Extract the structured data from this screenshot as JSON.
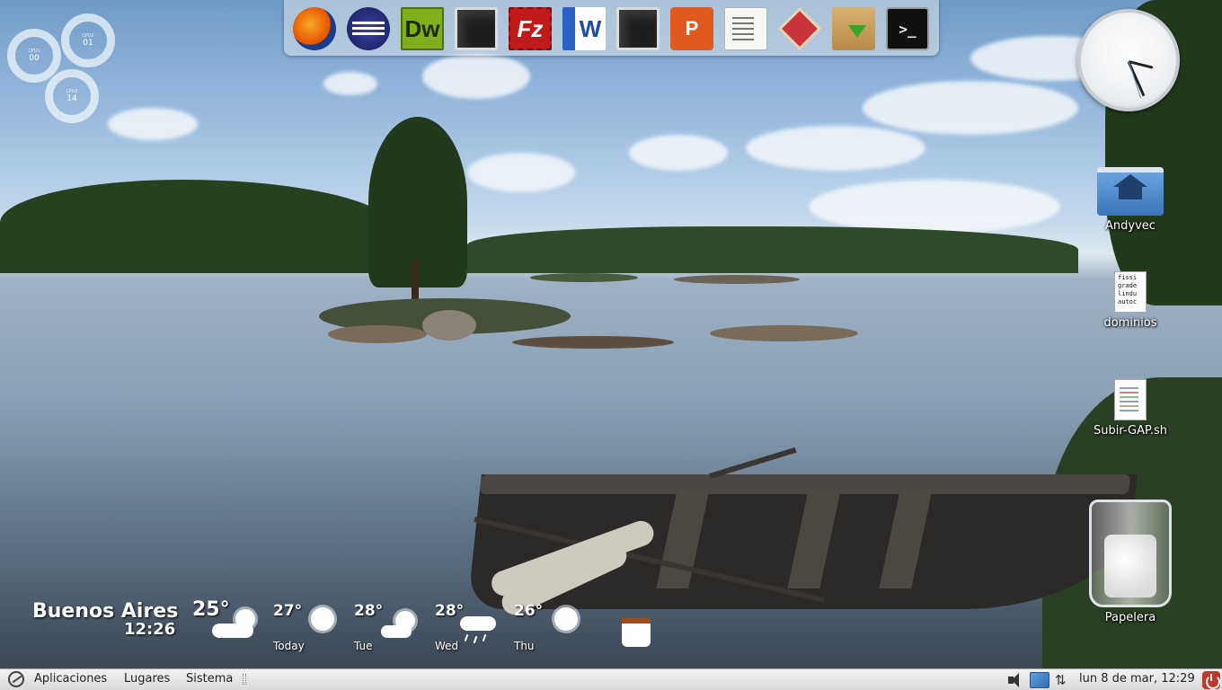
{
  "dock": {
    "items": [
      {
        "name": "firefox",
        "label": ""
      },
      {
        "name": "eclipse",
        "label": ""
      },
      {
        "name": "dreamweaver",
        "label": "Dw"
      },
      {
        "name": "screen-1",
        "label": ""
      },
      {
        "name": "filezilla",
        "label": "Fz"
      },
      {
        "name": "word",
        "label": "W"
      },
      {
        "name": "screen-2",
        "label": ""
      },
      {
        "name": "powerpoint",
        "label": "P"
      },
      {
        "name": "text-editor",
        "label": ""
      },
      {
        "name": "diamond-app",
        "label": ""
      },
      {
        "name": "package-installer",
        "label": ""
      },
      {
        "name": "terminal",
        "label": ">_"
      }
    ]
  },
  "cpu_gauges": [
    {
      "label": "CPU1",
      "value": "00"
    },
    {
      "label": "CPU2",
      "value": "01"
    },
    {
      "label": "CPU3",
      "value": "14"
    }
  ],
  "desktop": {
    "icons": [
      {
        "name": "home-folder",
        "label": "Andyvec"
      },
      {
        "name": "dominios-file",
        "label": "dominios",
        "preview": [
          "fissi",
          "grade",
          "lindu",
          "autoc"
        ]
      },
      {
        "name": "script-file",
        "label": "Subir-GAP.sh"
      },
      {
        "name": "trash",
        "label": "Papelera"
      }
    ]
  },
  "weather": {
    "city": "Buenos Aires",
    "time": "12:26",
    "current_temp": "25°",
    "forecast": [
      {
        "day": "Today",
        "temp": "27°",
        "icon": "sun-icon"
      },
      {
        "day": "Tue",
        "temp": "28°",
        "icon": "sun-cloud-icon"
      },
      {
        "day": "Wed",
        "temp": "28°",
        "icon": "rain-icon"
      },
      {
        "day": "Thu",
        "temp": "26°",
        "icon": "sun-icon"
      }
    ]
  },
  "panel": {
    "menu_applications": "Aplicaciones",
    "menu_places": "Lugares",
    "menu_system": "Sistema",
    "datetime": "lun  8 de mar, 12:29",
    "updown": "⇅"
  },
  "colors": {
    "panel_bg": "#dadada",
    "dock_bg": "#dce1e6",
    "power_red": "#c0392b"
  }
}
